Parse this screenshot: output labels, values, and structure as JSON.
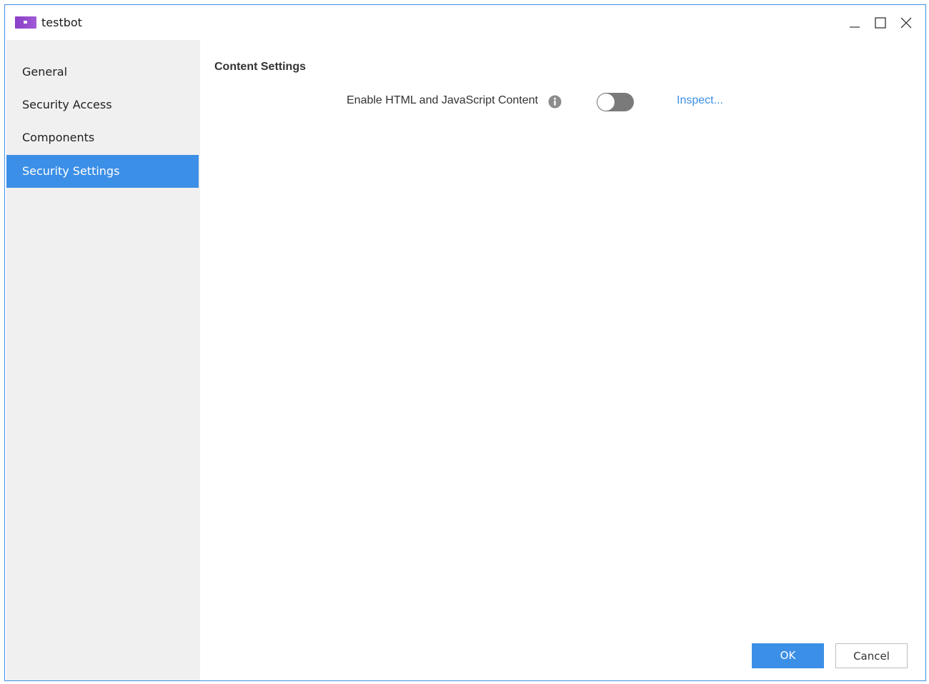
{
  "window": {
    "title": "testbot",
    "icon": "app-bot-icon",
    "controls": [
      "minimize-icon",
      "maximize-icon",
      "close-icon"
    ]
  },
  "sidebar": {
    "items": [
      {
        "label": "General",
        "active": false
      },
      {
        "label": "Security Access",
        "active": false
      },
      {
        "label": "Components",
        "active": false
      },
      {
        "label": "Security Settings",
        "active": true
      }
    ]
  },
  "main": {
    "section_title": "Content Settings",
    "setting": {
      "label": "Enable HTML and JavaScript Content",
      "info_icon": "info-icon",
      "enabled": false,
      "link_label": "Inspect..."
    }
  },
  "footer": {
    "ok_label": "OK",
    "cancel_label": "Cancel"
  },
  "colors": {
    "accent": "#3c8fe6",
    "sidebar_bg": "#f0f0f0",
    "toggle_off": "#7a7a7a",
    "icon_purple": "#8a3fc8"
  }
}
